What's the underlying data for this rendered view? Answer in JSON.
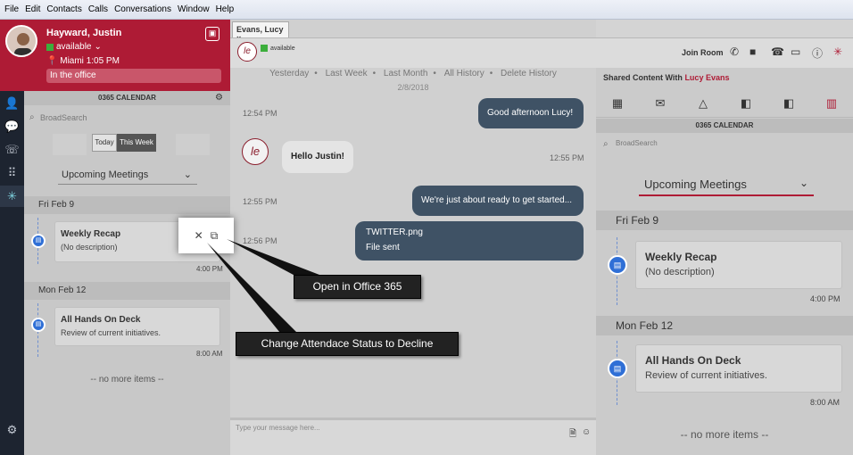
{
  "menu": [
    "File",
    "Edit",
    "Contacts",
    "Calls",
    "Conversations",
    "Window",
    "Help"
  ],
  "profile": {
    "name": "Hayward, Justin",
    "status": "available",
    "location": "Miami",
    "time": "1:05 PM",
    "note": "In the office"
  },
  "calendar": {
    "title": "0365 CALENDAR",
    "search_placeholder": "BroadSearch",
    "seg_today": "Today",
    "seg_week": "This Week",
    "filter": "Upcoming Meetings",
    "days": [
      {
        "label": "Fri Feb 9",
        "title": "Weekly Recap",
        "desc": "(No description)",
        "time": "4:00 PM"
      },
      {
        "label": "Mon Feb 12",
        "title": "All Hands On Deck",
        "desc": "Review of current initiatives.",
        "time": "8:00 AM"
      }
    ],
    "no_more": "-- no more items --"
  },
  "chat": {
    "tab": "Evans, Lucy",
    "contact_initials": "le",
    "contact_status": "available",
    "history": [
      "Yesterday",
      "•",
      "Last Week",
      "•",
      "Last Month",
      "•",
      "All History",
      "•",
      "Delete History"
    ],
    "date": "2/8/2018",
    "messages": [
      {
        "time": "12:54 PM",
        "text": "Good afternoon Lucy!"
      },
      {
        "text": "Hello Justin!",
        "time": "12:55 PM"
      },
      {
        "time": "12:55 PM",
        "text": "We're just about ready to get started..."
      },
      {
        "time": "12:56 PM",
        "file": "TWITTER.png",
        "sub": "File sent"
      }
    ],
    "compose_placeholder": "Type your message here..."
  },
  "header": {
    "join_room": "Join Room"
  },
  "shared": {
    "title_prefix": "Shared Content With",
    "contact": "Lucy Evans",
    "calendar_title": "0365 CALENDAR",
    "search_placeholder": "BroadSearch",
    "filter": "Upcoming Meetings",
    "days": [
      {
        "label": "Fri Feb 9",
        "title": "Weekly Recap",
        "desc": "(No description)",
        "time": "4:00 PM"
      },
      {
        "label": "Mon Feb 12",
        "title": "All Hands On Deck",
        "desc": "Review of current initiatives.",
        "time": "8:00 AM"
      }
    ],
    "no_more": "-- no more items --"
  },
  "callouts": {
    "open": "Open in Office 365",
    "decline": "Change Attendace Status to Decline"
  },
  "tooltip": {
    "close": "✕",
    "open": "⧉"
  }
}
